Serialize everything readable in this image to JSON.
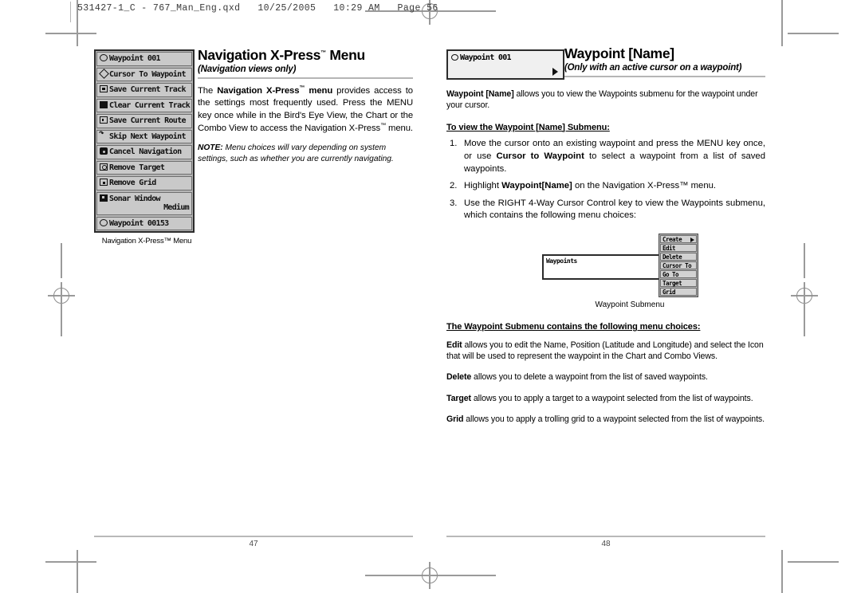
{
  "slug": "531427-1_C - 767_Man_Eng.qxd   10/25/2005   10:29 AM   Page 56",
  "left_page": {
    "folio": "47",
    "figure": {
      "caption": "Navigation X-Press™ Menu",
      "rows": [
        {
          "icon": "waypoint-circle-icon",
          "label": "Waypoint 001",
          "value": ""
        },
        {
          "icon": "cursor-diamond-icon",
          "label": "Cursor To Waypoint",
          "value": ""
        },
        {
          "icon": "save-square-icon",
          "label": "Save Current Track",
          "value": ""
        },
        {
          "icon": "clear-filled-x-icon",
          "label": "Clear Current Track",
          "value": ""
        },
        {
          "icon": "save-route-icon",
          "label": "Save Current Route",
          "value": ""
        },
        {
          "icon": "skip-arrow-icon",
          "label": "Skip Next Waypoint",
          "value": ""
        },
        {
          "icon": "cancel-nav-icon",
          "label": "Cancel Navigation",
          "value": ""
        },
        {
          "icon": "remove-target-icon",
          "label": "Remove Target",
          "value": ""
        },
        {
          "icon": "remove-grid-icon",
          "label": "Remove Grid",
          "value": ""
        },
        {
          "icon": "sonar-window-icon",
          "label": "Sonar Window",
          "value": "Medium"
        },
        {
          "icon": "waypoint-circle-icon",
          "label": "Waypoint 00153",
          "value": ""
        }
      ]
    },
    "heading": "Navigation X-Press",
    "heading_tm": "™",
    "heading_tail": " Menu",
    "subheading": "(Navigation views only)",
    "body_p1_a": "The ",
    "body_p1_b": "Navigation X-Press",
    "body_p1_c": " menu",
    "body_p1_d": " provides access to the settings most frequently used.  Press the MENU key once while in the Bird's Eye View, the Chart or the Combo View to access the Navigation X-Press",
    "body_p1_e": " menu.",
    "note_label": "NOTE:",
    "note_text": " Menu choices will vary depending on system settings, such as whether you are currently navigating."
  },
  "right_page": {
    "folio": "48",
    "field_figure": {
      "icon": "waypoint-circle-icon",
      "label": "Waypoint 001",
      "arrow": "right-arrow-icon"
    },
    "heading": "Waypoint [Name]",
    "subheading": "(Only with an active cursor on a waypoint)",
    "intro_bold": "Waypoint [Name]",
    "intro_rest": " allows you to view the Waypoints submenu for the waypoint under your cursor.",
    "steps_title": "To view the Waypoint [Name] Submenu:",
    "steps": [
      {
        "num": "1.",
        "parts": [
          {
            "t": "Move the cursor onto an existing waypoint and press the MENU key once, or use ",
            "b": false
          },
          {
            "t": "Cursor to Waypoint",
            "b": true
          },
          {
            "t": " to select a waypoint from a list of saved waypoints.",
            "b": false
          }
        ]
      },
      {
        "num": "2.",
        "parts": [
          {
            "t": "Highlight ",
            "b": false
          },
          {
            "t": "Waypoint[Name]",
            "b": true
          },
          {
            "t": " on the Navigation X-Press™ menu.",
            "b": false
          }
        ]
      },
      {
        "num": "3.",
        "parts": [
          {
            "t": "Use the RIGHT 4-Way Cursor Control key to view the Waypoints submenu, which contains the following menu choices:",
            "b": false
          }
        ]
      }
    ],
    "submenu_figure": {
      "caption": "Waypoint Submenu",
      "left_label": "Waypoints",
      "items": [
        {
          "label": "Create",
          "arrow": true
        },
        {
          "label": "Edit",
          "arrow": false
        },
        {
          "label": "Delete",
          "arrow": false
        },
        {
          "label": "Cursor To",
          "arrow": false
        },
        {
          "label": "Go To",
          "arrow": false
        },
        {
          "label": "Target",
          "arrow": false
        },
        {
          "label": "Grid",
          "arrow": false
        }
      ]
    },
    "choices_title": "The Waypoint Submenu contains the following menu choices:",
    "choices": [
      {
        "term": "Edit",
        "desc": " allows you to edit the Name, Position (Latitude and Longitude) and select the Icon that will be used to represent the waypoint in the Chart and Combo Views."
      },
      {
        "term": "Delete",
        "desc": " allows you to delete a waypoint from the list of saved waypoints."
      },
      {
        "term": "Target",
        "desc": " allows you to apply a target to a waypoint selected from the list of waypoints."
      },
      {
        "term": "Grid",
        "desc": " allows you to apply a trolling grid to a waypoint selected from the list of waypoints."
      }
    ]
  },
  "colors": {
    "lcd_bg": "#b6b6b6",
    "lcd_row": "#c9c9c9",
    "rule": "#b5b5b5",
    "mark": "#9a9a9a"
  }
}
